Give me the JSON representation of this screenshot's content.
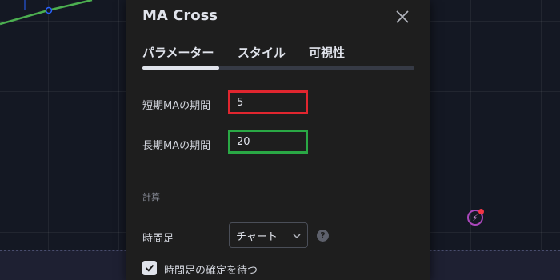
{
  "dialog": {
    "title": "MA Cross",
    "tabs": [
      {
        "label": "パラメーター",
        "active": true
      },
      {
        "label": "スタイル",
        "active": false
      },
      {
        "label": "可視性",
        "active": false
      }
    ]
  },
  "inputs": {
    "short_label": "短期MAの期間",
    "short_value": "5",
    "long_label": "長期MAの期間",
    "long_value": "20"
  },
  "calc": {
    "section_label": "計算",
    "timeframe_label": "時間足",
    "timeframe_value": "チャート",
    "help_icon_text": "?",
    "wait_label": "時間足の確定を待つ",
    "wait_checked": true
  },
  "colors": {
    "highlight_short": "#e0262f",
    "highlight_long": "#2aa845",
    "chart_line": "#4caf50",
    "alert_badge": "#ab47bc"
  },
  "icons": {
    "close": "close-icon",
    "chevron": "chevron-down-icon",
    "help": "help-icon",
    "check": "check-icon",
    "alert": "lightning-alert-icon"
  }
}
